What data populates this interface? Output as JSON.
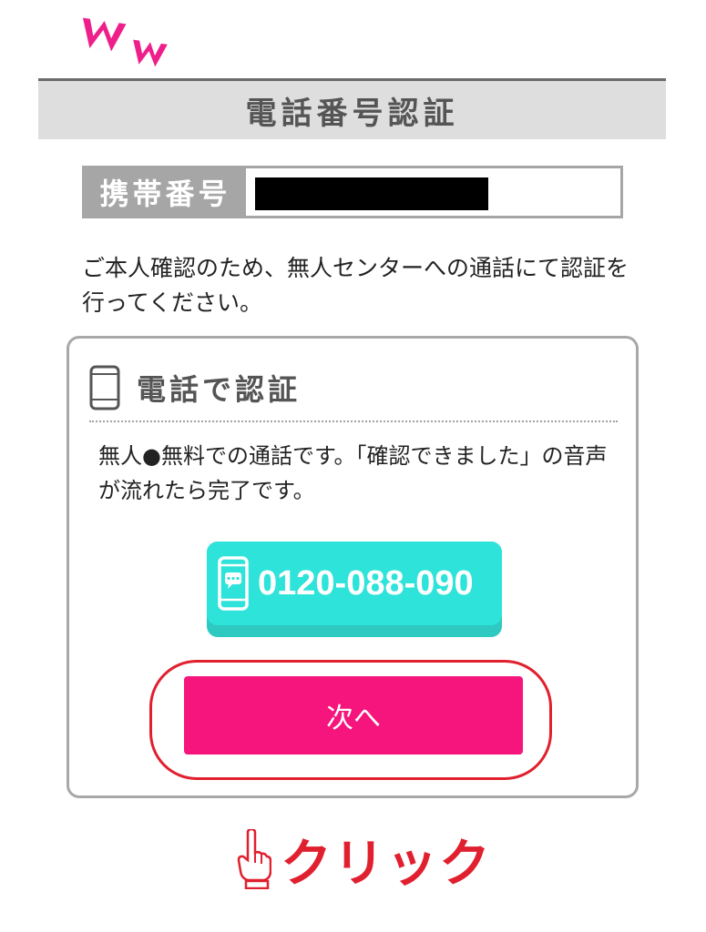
{
  "logo": {
    "text": "ww",
    "color": "#ee1f8a"
  },
  "header": {
    "title": "電話番号認証"
  },
  "phone_field": {
    "label": "携帯番号",
    "value_redacted": true
  },
  "intro": {
    "text": "ご本人確認のため、無人センターへの通話にて認証を行ってください。"
  },
  "card": {
    "title": "電話で認証",
    "description": "無人●無料での通話です。「確認できました」の音声が流れたら完了です。",
    "tel_button": {
      "number": "0120-088-090",
      "color": "#2ee3d9"
    },
    "next_button": {
      "label": "次へ",
      "color": "#f5157c"
    }
  },
  "annotation": {
    "text": "クリック",
    "color": "#e0202e",
    "icon": "pointing-hand-icon"
  }
}
